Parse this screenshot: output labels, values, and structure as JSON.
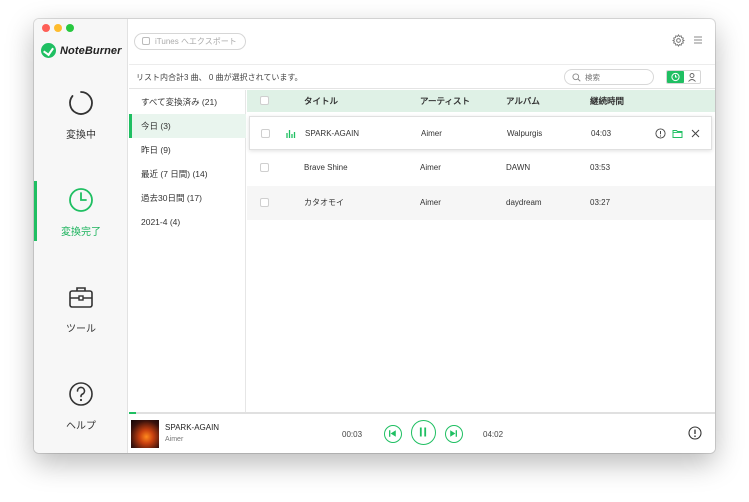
{
  "app": {
    "name": "NoteBurner",
    "accent": "#1fbf62"
  },
  "sidebar": {
    "items": [
      {
        "label": "変換中",
        "icon": "converting-ring-icon"
      },
      {
        "label": "変換完了",
        "icon": "clock-icon"
      },
      {
        "label": "ツール",
        "icon": "toolbox-icon"
      },
      {
        "label": "ヘルプ",
        "icon": "help-icon"
      }
    ],
    "active_index": 1
  },
  "toolbar": {
    "export_label": "iTunes へエクスポート",
    "settings_icon": "gear-icon",
    "menu_icon": "hamburger-menu-icon"
  },
  "status": {
    "text": "リスト内合計3 曲、 0 曲が選択されています。",
    "search_placeholder": "検索"
  },
  "filters": [
    {
      "label": "すべて変換済み (21)"
    },
    {
      "label": "今日 (3)"
    },
    {
      "label": "昨日 (9)"
    },
    {
      "label": "最近 (7 日間) (14)"
    },
    {
      "label": "過去30日間 (17)"
    },
    {
      "label": "2021-4 (4)"
    }
  ],
  "table": {
    "headers": {
      "title": "タイトル",
      "artist": "アーティスト",
      "album": "アルバム",
      "duration": "継続時間"
    },
    "rows": [
      {
        "title": "SPARK-AGAIN",
        "artist": "Aimer",
        "album": "Walpurgis",
        "duration": "04:03"
      },
      {
        "title": "Brave Shine",
        "artist": "Aimer",
        "album": "DAWN",
        "duration": "03:53"
      },
      {
        "title": "カタオモイ",
        "artist": "Aimer",
        "album": "daydream",
        "duration": "03:27"
      }
    ]
  },
  "player": {
    "title": "SPARK-AGAIN",
    "artist": "Aimer",
    "current_time": "00:03",
    "total_time": "04:02",
    "progress_fraction": 0.012
  }
}
